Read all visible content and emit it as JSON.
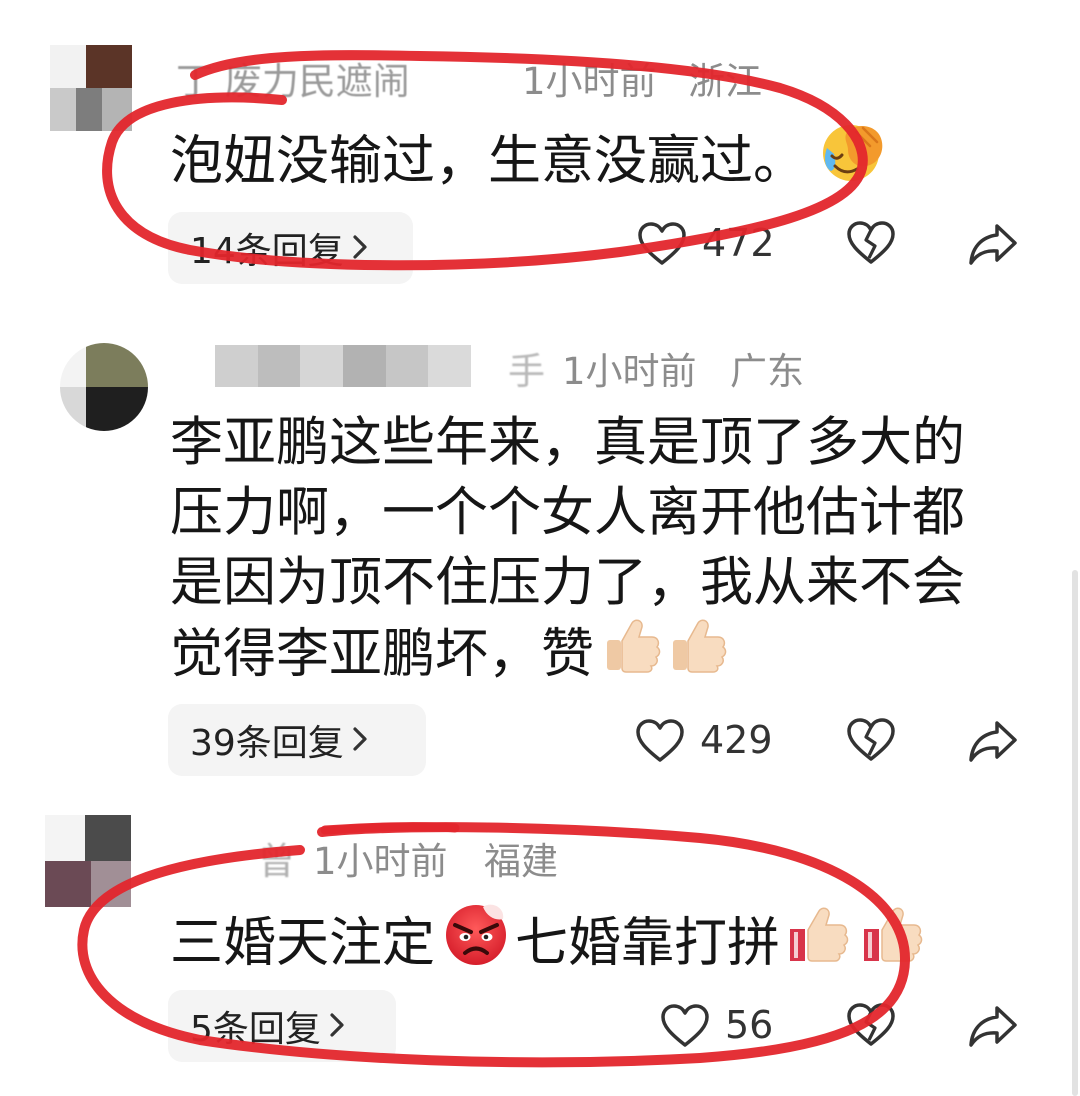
{
  "colors": {
    "annotation_red": "#e3262c",
    "text": "#161616",
    "meta": "#8c8c8c",
    "reply_bg": "#f4f4f4",
    "icon": "#333333"
  },
  "action_icons": [
    "heart-icon",
    "broken-heart-icon",
    "share-icon"
  ],
  "comments": [
    {
      "name": "丁 废力民遮闹",
      "time": "1小时前",
      "location": "浙江",
      "text": [
        "泡妞没输过，生意没赢过。"
      ],
      "emojis": [
        "facepalm-emoji"
      ],
      "replies": "14条回复",
      "likes": "472"
    },
    {
      "name": "手",
      "time": "1小时前",
      "location": "广东",
      "text": [
        "李亚鹏这些年来，真是顶了多大的",
        "压力啊，一个个女人离开他估计都",
        "是因为顶不住压力了，我从来不会",
        "觉得李亚鹏坏，赞"
      ],
      "emojis": [
        "thumbs-up-emoji",
        "thumbs-up-emoji"
      ],
      "replies": "39条回复",
      "likes": "429"
    },
    {
      "name": "曾",
      "time": "1小时前",
      "location": "福建",
      "text": [
        "三婚天注定",
        "七婚靠打拼"
      ],
      "emojis": [
        "angry-face-emoji",
        "thumbs-up-emoji",
        "thumbs-up-emoji"
      ],
      "replies": "5条回复",
      "likes": "56"
    }
  ]
}
